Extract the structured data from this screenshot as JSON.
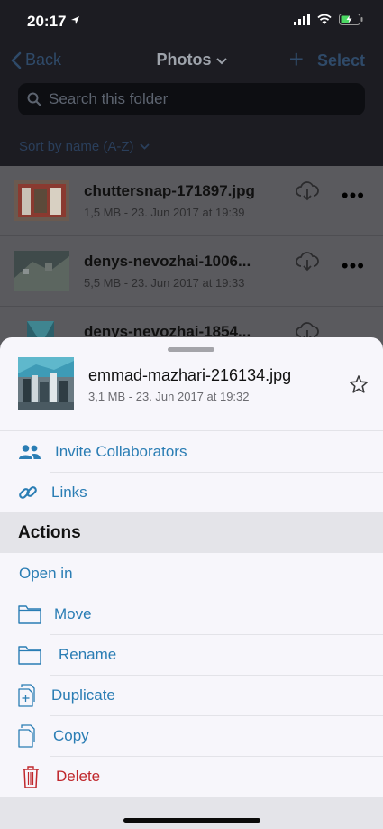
{
  "status_bar": {
    "time": "20:17"
  },
  "navbar": {
    "back_label": "Back",
    "title": "Photos",
    "select_label": "Select"
  },
  "search": {
    "placeholder": "Search this folder"
  },
  "sort": {
    "label": "Sort by name (A-Z)"
  },
  "files": [
    {
      "name": "chuttersnap-171897.jpg",
      "meta": "1,5 MB - 23. Jun 2017 at 19:39"
    },
    {
      "name": "denys-nevozhai-1006...",
      "meta": "5,5 MB - 23. Jun 2017 at 19:33"
    },
    {
      "name": "denys-nevozhai-1854...",
      "meta": ""
    }
  ],
  "sheet": {
    "file_name": "emmad-mazhari-216134.jpg",
    "file_meta": "3,1 MB - 23. Jun 2017 at 19:32",
    "share_items": [
      {
        "label": "Invite Collaborators",
        "icon": "people-icon"
      },
      {
        "label": "Links",
        "icon": "link-icon"
      }
    ],
    "actions_header": "Actions",
    "actions": [
      {
        "label": "Open in",
        "icon": ""
      },
      {
        "label": "Move",
        "icon": "folder-icon"
      },
      {
        "label": "Rename",
        "icon": "folder-icon"
      },
      {
        "label": "Duplicate",
        "icon": "duplicate-icon"
      },
      {
        "label": "Copy",
        "icon": "copy-icon"
      },
      {
        "label": "Delete",
        "icon": "trash-icon"
      }
    ]
  },
  "colors": {
    "accent": "#2a7db4",
    "destructive": "#c0282d",
    "sheet_bg": "#f7f6fb"
  }
}
